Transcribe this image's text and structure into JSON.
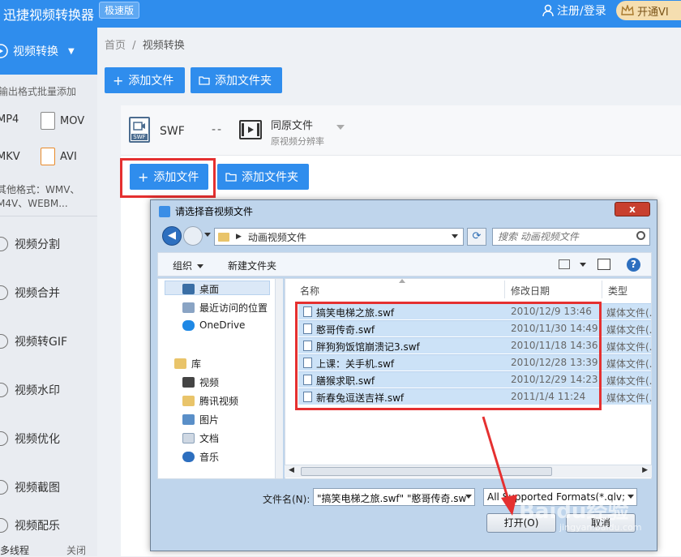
{
  "app": {
    "title": "迅捷视频转换器",
    "badge": "极速版",
    "login_label": "注册/登录",
    "vip_label": "开通VI"
  },
  "sidebar": {
    "active": "视频转换",
    "note": "输出格式批量添加",
    "formats": [
      "MP4",
      "MOV",
      "MKV",
      "AVI"
    ],
    "other_formats_line1": "其他格式：WMV、",
    "other_formats_line2": "M4V、WEBM...",
    "items": [
      "视频分割",
      "视频合并",
      "视频转GIF",
      "视频水印",
      "视频优化",
      "视频截图",
      "视频配乐"
    ],
    "bottom_left": "多线程",
    "bottom_right": "关闭"
  },
  "breadcrumb": {
    "home": "首页",
    "sep": "/",
    "current": "视频转换"
  },
  "toolbar": {
    "add_file": "添加文件",
    "add_folder": "添加文件夹"
  },
  "conversion": {
    "input_format": "SWF",
    "swf_icon_text": "SWF",
    "dashes": "--",
    "output_name": "同原文件",
    "output_sub": "原视频分辨率",
    "add_file": "添加文件",
    "add_folder": "添加文件夹"
  },
  "dialog": {
    "title": "请选择音视频文件",
    "close": "x",
    "address": "动画视频文件",
    "search_placeholder": "搜索 动画视频文件",
    "organize": "组织",
    "new_folder": "新建文件夹",
    "help": "?",
    "nav": [
      {
        "label": "桌面",
        "icon": "desktop-icon",
        "color": "#3a6ea5"
      },
      {
        "label": "最近访问的位置",
        "icon": "recent-places-icon",
        "color": "#8aa4c4"
      },
      {
        "label": "OneDrive",
        "icon": "onedrive-icon",
        "color": "#1e88e5"
      },
      {
        "label": "库",
        "icon": "library-icon",
        "color": "#e9c46a"
      },
      {
        "label": "视频",
        "icon": "video-library-icon",
        "color": "#444"
      },
      {
        "label": "腾讯视频",
        "icon": "folder-icon",
        "color": "#e9c46a"
      },
      {
        "label": "图片",
        "icon": "pictures-icon",
        "color": "#5a8fc8"
      },
      {
        "label": "文档",
        "icon": "documents-icon",
        "color": "#cfd8e3"
      },
      {
        "label": "音乐",
        "icon": "music-icon",
        "color": "#2d6fbf"
      }
    ],
    "columns": {
      "name": "名称",
      "date": "修改日期",
      "type": "类型"
    },
    "files": [
      {
        "name": "搞笑电梯之旅.swf",
        "date": "2010/12/9 13:46",
        "type": "媒体文件(."
      },
      {
        "name": "憨哥传奇.swf",
        "date": "2010/11/30 14:49",
        "type": "媒体文件(."
      },
      {
        "name": "胖狗狗饭馆崩溃记3.swf",
        "date": "2010/11/18 14:36",
        "type": "媒体文件(."
      },
      {
        "name": "上课：关手机.swf",
        "date": "2010/12/28 13:39",
        "type": "媒体文件(."
      },
      {
        "name": "膳猴求职.swf",
        "date": "2010/12/29 14:23",
        "type": "媒体文件(."
      },
      {
        "name": "新春兔逗送吉祥.swf",
        "date": "2011/1/4 11:24",
        "type": "媒体文件(."
      }
    ],
    "filename_label": "文件名(N):",
    "filename_value": "\"搞笑电梯之旅.swf\" \"憨哥传奇.sw",
    "filetype_value": "All Supported Formats(*.qlv;",
    "open_button": "打开(O)",
    "cancel_button": "取消"
  },
  "watermark": {
    "main": "Baidu经验",
    "sub": "jingyan.baidu.com"
  },
  "colors": {
    "brand_blue": "#2f8ded",
    "highlight_red": "#e53030",
    "selection_blue": "#cce2f7"
  }
}
